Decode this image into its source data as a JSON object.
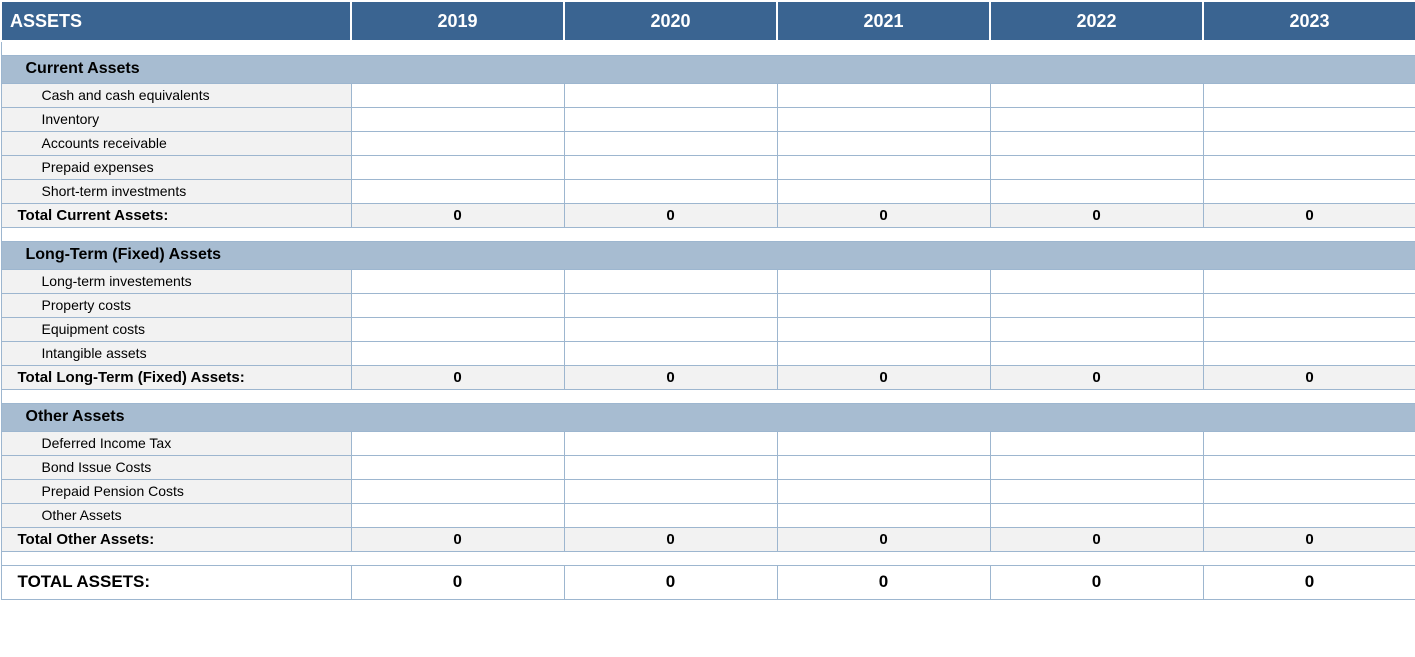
{
  "header": {
    "title": "ASSETS",
    "years": [
      "2019",
      "2020",
      "2021",
      "2022",
      "2023"
    ]
  },
  "sections": [
    {
      "name": "Current Assets",
      "lines": [
        {
          "label": "Cash and cash equivalents",
          "values": [
            "",
            "",
            "",
            "",
            ""
          ]
        },
        {
          "label": "Inventory",
          "values": [
            "",
            "",
            "",
            "",
            ""
          ]
        },
        {
          "label": "Accounts receivable",
          "values": [
            "",
            "",
            "",
            "",
            ""
          ]
        },
        {
          "label": "Prepaid expenses",
          "values": [
            "",
            "",
            "",
            "",
            ""
          ]
        },
        {
          "label": "Short-term investments",
          "values": [
            "",
            "",
            "",
            "",
            ""
          ]
        }
      ],
      "subtotal": {
        "label": "Total Current Assets:",
        "values": [
          "0",
          "0",
          "0",
          "0",
          "0"
        ]
      }
    },
    {
      "name": "Long-Term (Fixed) Assets",
      "lines": [
        {
          "label": "Long-term investements",
          "values": [
            "",
            "",
            "",
            "",
            ""
          ]
        },
        {
          "label": "Property costs",
          "values": [
            "",
            "",
            "",
            "",
            ""
          ]
        },
        {
          "label": "Equipment costs",
          "values": [
            "",
            "",
            "",
            "",
            ""
          ]
        },
        {
          "label": "Intangible assets",
          "values": [
            "",
            "",
            "",
            "",
            ""
          ]
        }
      ],
      "subtotal": {
        "label": "Total Long-Term (Fixed) Assets:",
        "values": [
          "0",
          "0",
          "0",
          "0",
          "0"
        ]
      }
    },
    {
      "name": "Other Assets",
      "lines": [
        {
          "label": "Deferred Income Tax",
          "values": [
            "",
            "",
            "",
            "",
            ""
          ]
        },
        {
          "label": "Bond Issue Costs",
          "values": [
            "",
            "",
            "",
            "",
            ""
          ]
        },
        {
          "label": "Prepaid Pension Costs",
          "values": [
            "",
            "",
            "",
            "",
            ""
          ]
        },
        {
          "label": "Other Assets",
          "values": [
            "",
            "",
            "",
            "",
            ""
          ]
        }
      ],
      "subtotal": {
        "label": "Total Other Assets:",
        "values": [
          "0",
          "0",
          "0",
          "0",
          "0"
        ]
      }
    }
  ],
  "grand_total": {
    "label": "TOTAL ASSETS:",
    "values": [
      "0",
      "0",
      "0",
      "0",
      "0"
    ]
  }
}
